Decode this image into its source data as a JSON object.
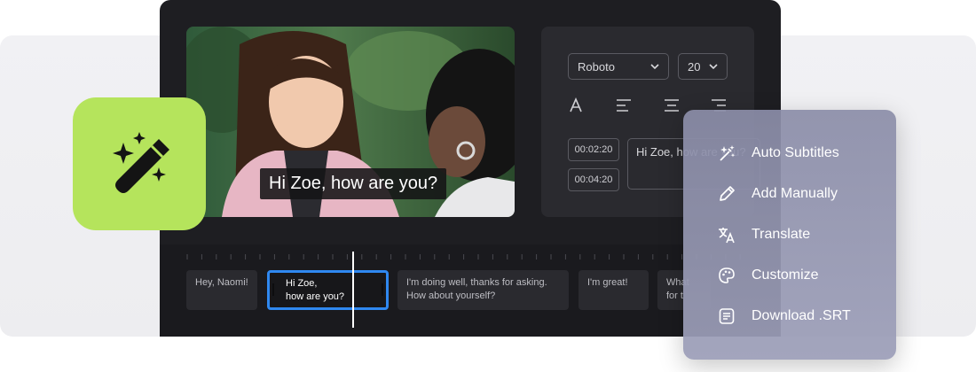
{
  "video": {
    "caption": "Hi Zoe, how are you?"
  },
  "style_panel": {
    "font_family": "Roboto",
    "font_size": "20",
    "timestamps": [
      "00:02:20",
      "00:04:20"
    ],
    "subtitle_preview": "Hi Zoe, how are you?"
  },
  "timeline": {
    "clips": [
      {
        "line1": "Hey, Naomi!",
        "line2": ""
      },
      {
        "line1": "Hi Zoe,",
        "line2": "how are you?"
      },
      {
        "line1": "I'm doing well, thanks for asking.",
        "line2": "How about yourself?"
      },
      {
        "line1": "I'm great!",
        "line2": ""
      },
      {
        "line1": "What",
        "line2": "for t"
      }
    ]
  },
  "menu": {
    "items": [
      {
        "label": "Auto Subtitles",
        "icon": "magic-wand-icon"
      },
      {
        "label": "Add Manually",
        "icon": "pencil-icon"
      },
      {
        "label": "Translate",
        "icon": "translate-icon"
      },
      {
        "label": "Customize",
        "icon": "palette-icon"
      },
      {
        "label": "Download .SRT",
        "icon": "document-icon"
      }
    ]
  },
  "colors": {
    "editor_bg": "#1e1e22",
    "badge_green": "#b5e45c",
    "selection_blue": "#2f88f0",
    "menu_bg": "#8b8da8"
  }
}
